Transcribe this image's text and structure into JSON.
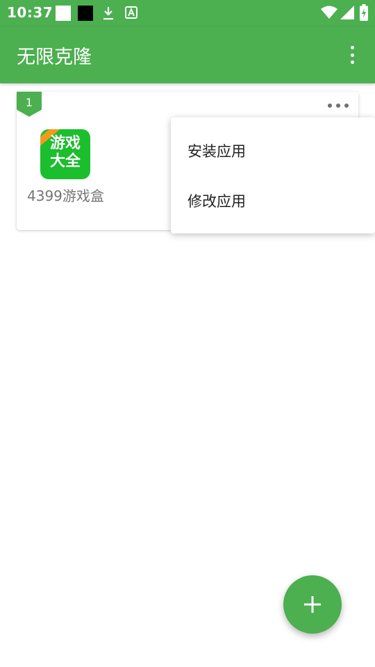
{
  "status_bar": {
    "time": "10:37",
    "icons": [
      "white-square-icon",
      "black-square-icon",
      "download-icon",
      "keyboard-a-icon",
      "wifi-icon",
      "signal-icon",
      "battery-charging-icon"
    ]
  },
  "app_bar": {
    "title": "无限克隆",
    "overflow_icon": "more-vert-icon"
  },
  "card": {
    "badge_number": "1",
    "more_icon": "more-horiz-icon",
    "app_icon_text_line1": "游戏",
    "app_icon_text_line2": "大全",
    "app_name": "4399游戏盒"
  },
  "popup_menu": {
    "items": [
      {
        "label": "安装应用"
      },
      {
        "label": "修改应用"
      }
    ]
  },
  "fab": {
    "icon": "add-icon"
  },
  "colors": {
    "primary": "#4CAF50",
    "app_icon_bg": "#1BBF2E",
    "app_icon_ribbon": "#F39A1E",
    "text_secondary": "#757575",
    "text_primary": "#212121"
  }
}
